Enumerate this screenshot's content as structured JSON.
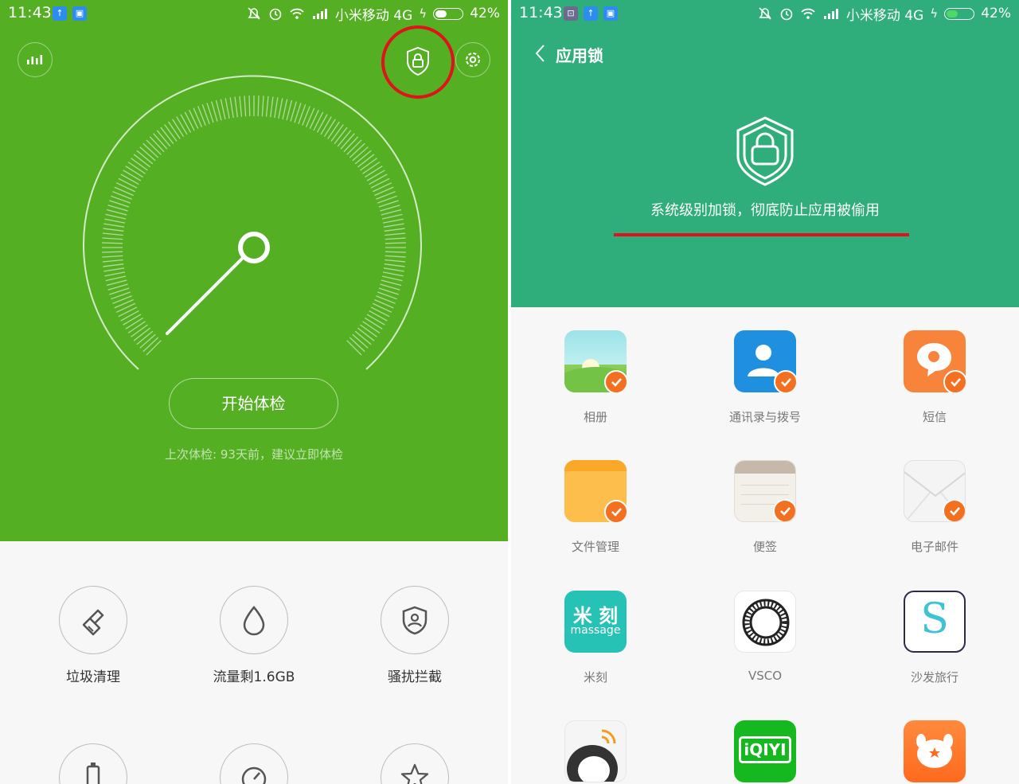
{
  "status_bar": {
    "time": "11:43",
    "carrier": "小米移动 4G",
    "battery": "42%",
    "notif_icons": [
      "upload-icon",
      "app-icon"
    ]
  },
  "left": {
    "icons": [
      "stats-icon",
      "shield-lock-icon",
      "settings-icon"
    ],
    "start_button": "开始体检",
    "last_check": "上次体检: 93天前，建议立即体检",
    "tools": [
      {
        "label": "垃圾清理",
        "icon": "broom-icon"
      },
      {
        "label": "流量剩1.6GB",
        "icon": "drop-icon"
      },
      {
        "label": "骚扰拦截",
        "icon": "shield-user-icon"
      }
    ],
    "tools_row2_icons": [
      "battery-icon",
      "timer-icon",
      "star-icon"
    ],
    "colors": {
      "green": "#54af23",
      "annotation": "#e0121b"
    }
  },
  "right": {
    "title": "应用锁",
    "description": "系统级别加锁，彻底防止应用被偷用",
    "colors": {
      "teal": "#2fad7a",
      "check": "#f37021"
    },
    "apps": [
      {
        "label": "相册",
        "checked": true
      },
      {
        "label": "通讯录与拨号",
        "checked": true
      },
      {
        "label": "短信",
        "checked": true
      },
      {
        "label": "文件管理",
        "checked": true
      },
      {
        "label": "便签",
        "checked": true
      },
      {
        "label": "电子邮件",
        "checked": true
      },
      {
        "label": "米刻",
        "checked": false,
        "icon_text_1": "米 刻",
        "icon_text_2": "massage"
      },
      {
        "label": "VSCO",
        "checked": false
      },
      {
        "label": "沙发旅行",
        "checked": false,
        "icon_text_1": "S"
      }
    ],
    "partial_apps_icon_text": [
      "",
      "iQIYI",
      ""
    ]
  }
}
